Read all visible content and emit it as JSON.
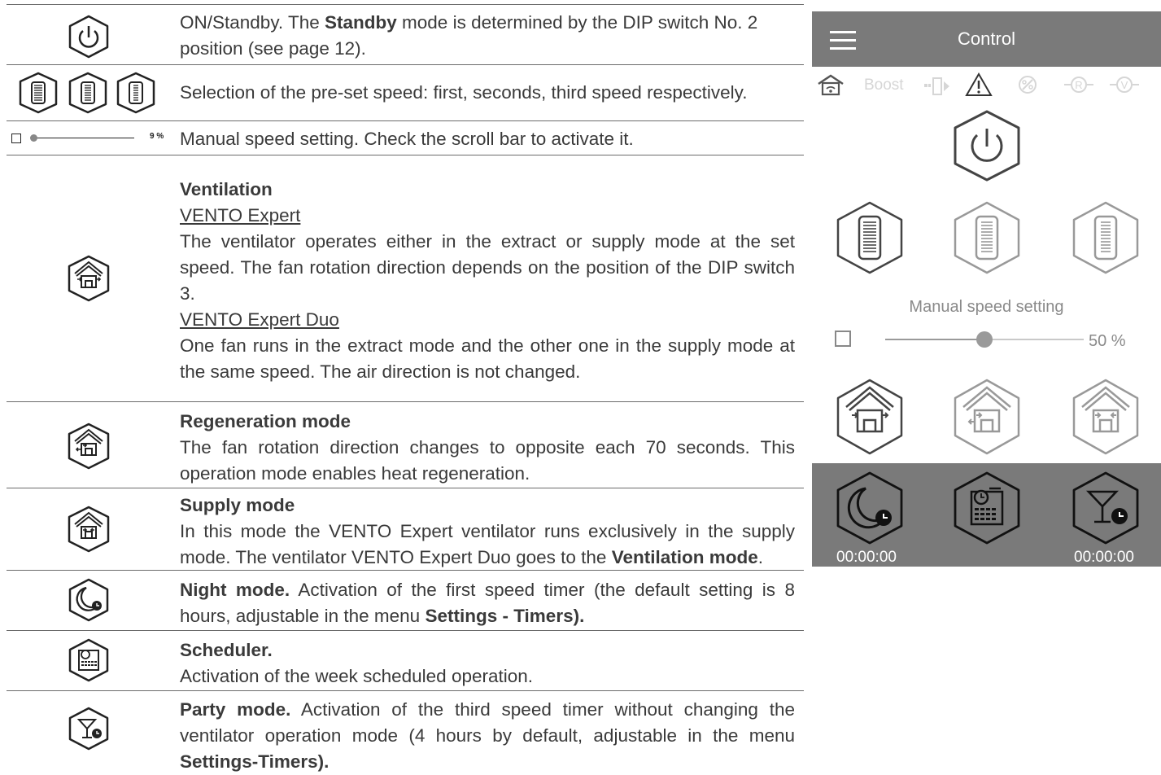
{
  "rows": {
    "standby": {
      "lead": "ON/Standby. The ",
      "bold": "Standby",
      "rest": " mode is determined by the DIP switch No. 2 position (see page 12)."
    },
    "speeds": "Selection of the pre-set speed: first, seconds, third speed respectively.",
    "manual": {
      "text": "Manual speed setting. Check the scroll bar to activate it.",
      "slider_label": "9 %"
    },
    "ventilation": {
      "title": "Ventilation",
      "sub1": "VENTO Expert",
      "p1": "The ventilator operates either in the extract or supply mode at the set speed. The fan rotation direction depends on the position of the DIP switch 3.",
      "sub2": "VENTO Expert Duo",
      "p2": "One fan runs in the extract mode and the other one in the supply mode at the same speed. The air direction is not changed."
    },
    "regeneration": {
      "title": "Regeneration mode",
      "p": "The fan rotation direction changes to opposite each 70 seconds. This operation mode enables heat regeneration."
    },
    "supply": {
      "title": "Supply mode",
      "p_lead": "In this mode the VENTO Expert ventilator runs exclusively in the supply mode. The ventilator VENTO Expert Duo goes to the ",
      "p_bold": "Ventilation mode",
      "p_end": "."
    },
    "night": {
      "title": "Night mode.",
      "p_lead": " Activation of the first speed timer (the default setting is 8 hours, adjustable in the menu ",
      "p_bold": "Settings - Timers)."
    },
    "scheduler": {
      "title": "Scheduler.",
      "p": "Activation of the week scheduled operation."
    },
    "party": {
      "title": "Party mode.",
      "p_lead": " Activation of the third speed timer without changing the ventilator operation mode (4 hours by default, adjustable in the menu ",
      "p_bold": "Settings-Timers)."
    }
  },
  "app": {
    "title": "Control",
    "boost_label": "Boost",
    "manual_label": "Manual speed setting",
    "manual_value": "50 %",
    "manual_level": 0.5,
    "night_timer": "00:00:00",
    "party_timer": "00:00:00",
    "colors": {
      "bar": "#7a7a7a",
      "icon_dark": "#3a3a3a",
      "icon_mid": "#777777",
      "icon_light": "#9a9a9a",
      "status_disabled": "#d6d6d6"
    },
    "icons": [
      "wifi-home-icon",
      "fan-icon",
      "warning-icon",
      "filter-icon",
      "r-icon",
      "v-icon"
    ]
  }
}
